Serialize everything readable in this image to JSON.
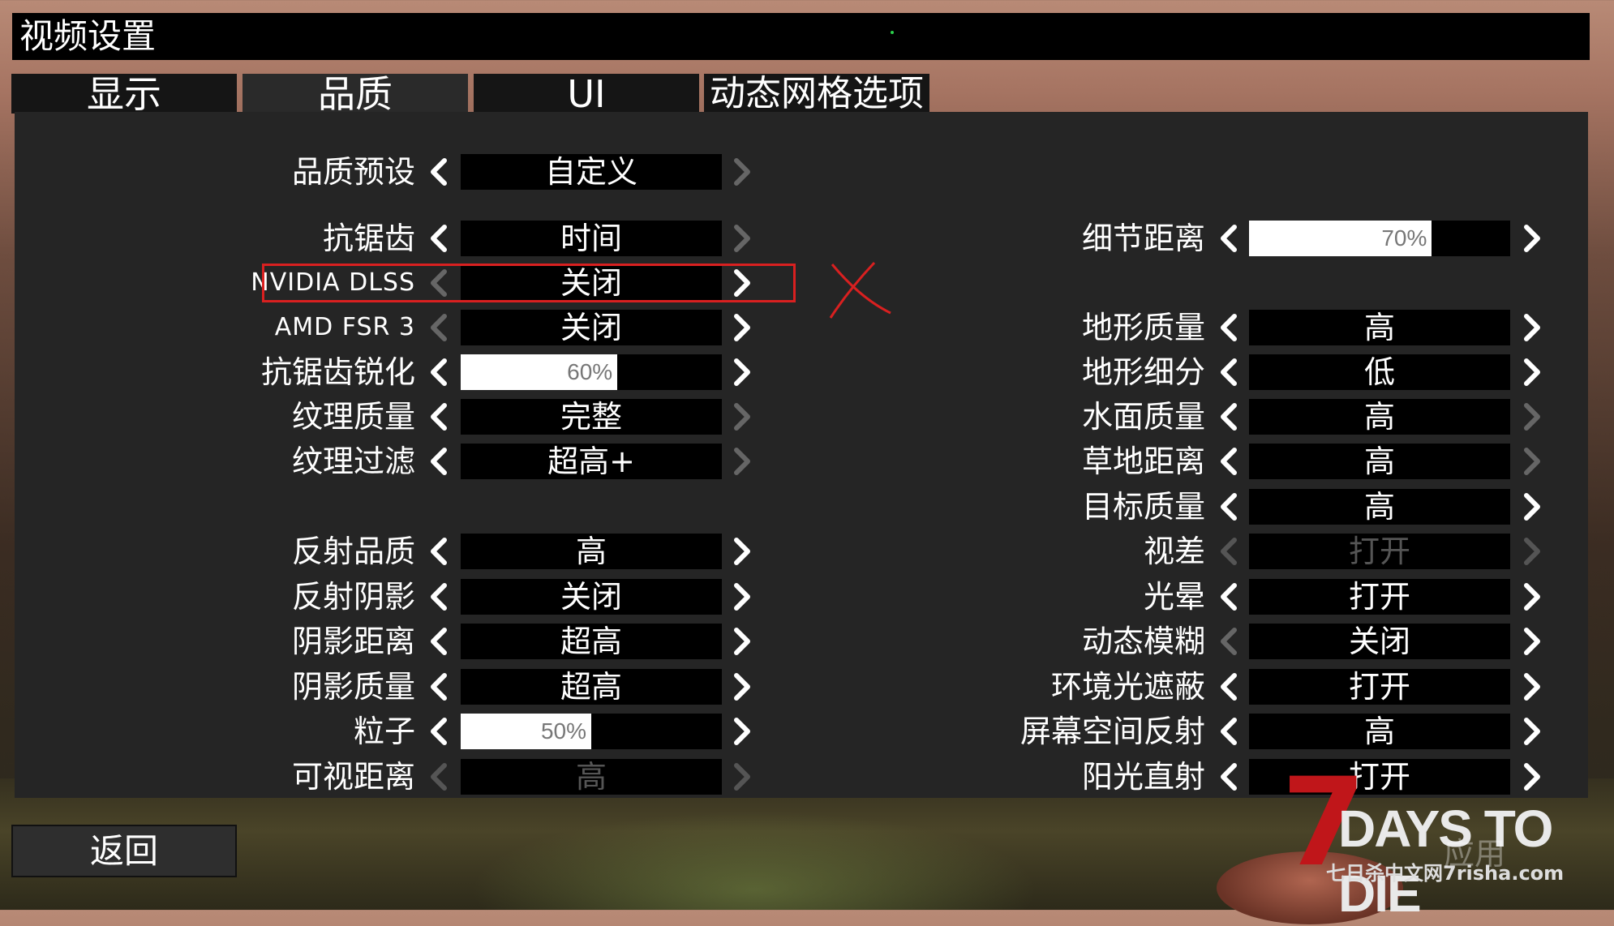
{
  "title": "视频设置",
  "tabs": {
    "display": "显示",
    "quality": "品质",
    "ui": "UI",
    "dynamic_mesh": "动态网格选项"
  },
  "left_settings": [
    {
      "label": "品质预设",
      "value": "自定义",
      "type": "select",
      "disabled": false
    },
    {
      "label": "抗锯齿",
      "value": "时间",
      "type": "select",
      "disabled": false
    },
    {
      "label": "NVIDIA DLSS",
      "value": "关闭",
      "type": "select",
      "disabled": false
    },
    {
      "label": "AMD FSR 3",
      "value": "关闭",
      "type": "select",
      "disabled": false
    },
    {
      "label": "抗锯齿锐化",
      "value": "60%",
      "type": "slider",
      "fraction": 0.6,
      "disabled": false
    },
    {
      "label": "纹理质量",
      "value": "完整",
      "type": "select",
      "disabled": false
    },
    {
      "label": "纹理过滤",
      "value": "超高+",
      "type": "select",
      "disabled": false
    },
    {
      "label": "反射品质",
      "value": "高",
      "type": "select",
      "disabled": false
    },
    {
      "label": "反射阴影",
      "value": "关闭",
      "type": "select",
      "disabled": false
    },
    {
      "label": "阴影距离",
      "value": "超高",
      "type": "select",
      "disabled": false
    },
    {
      "label": "阴影质量",
      "value": "超高",
      "type": "select",
      "disabled": false
    },
    {
      "label": "粒子",
      "value": "50%",
      "type": "slider",
      "fraction": 0.5,
      "disabled": false
    },
    {
      "label": "可视距离",
      "value": "高",
      "type": "select",
      "disabled": true
    }
  ],
  "right_settings": [
    {
      "label": "细节距离",
      "value": "70%",
      "type": "slider",
      "fraction": 0.7,
      "disabled": false
    },
    {
      "label": "地形质量",
      "value": "高",
      "type": "select",
      "disabled": false
    },
    {
      "label": "地形细分",
      "value": "低",
      "type": "select",
      "disabled": false
    },
    {
      "label": "水面质量",
      "value": "高",
      "type": "select",
      "disabled": false
    },
    {
      "label": "草地距离",
      "value": "高",
      "type": "select",
      "disabled": false
    },
    {
      "label": "目标质量",
      "value": "高",
      "type": "select",
      "disabled": false
    },
    {
      "label": "视差",
      "value": "打开",
      "type": "select",
      "disabled": true
    },
    {
      "label": "光晕",
      "value": "打开",
      "type": "select",
      "disabled": false
    },
    {
      "label": "动态模糊",
      "value": "关闭",
      "type": "select",
      "disabled": false
    },
    {
      "label": "环境光遮蔽",
      "value": "打开",
      "type": "select",
      "disabled": false
    },
    {
      "label": "屏幕空间反射",
      "value": "高",
      "type": "select",
      "disabled": false
    },
    {
      "label": "阳光直射",
      "value": "打开",
      "type": "select",
      "disabled": false
    }
  ],
  "back_label": "返回",
  "logo": {
    "seven": "7",
    "name": "DAYS TO DIE",
    "sub": "七日杀中文网7risha.com"
  },
  "watermark": "应用",
  "colors": {
    "highlight": "#d92020",
    "logo_red": "#c0161a",
    "status_dot": "#2bd04c"
  }
}
